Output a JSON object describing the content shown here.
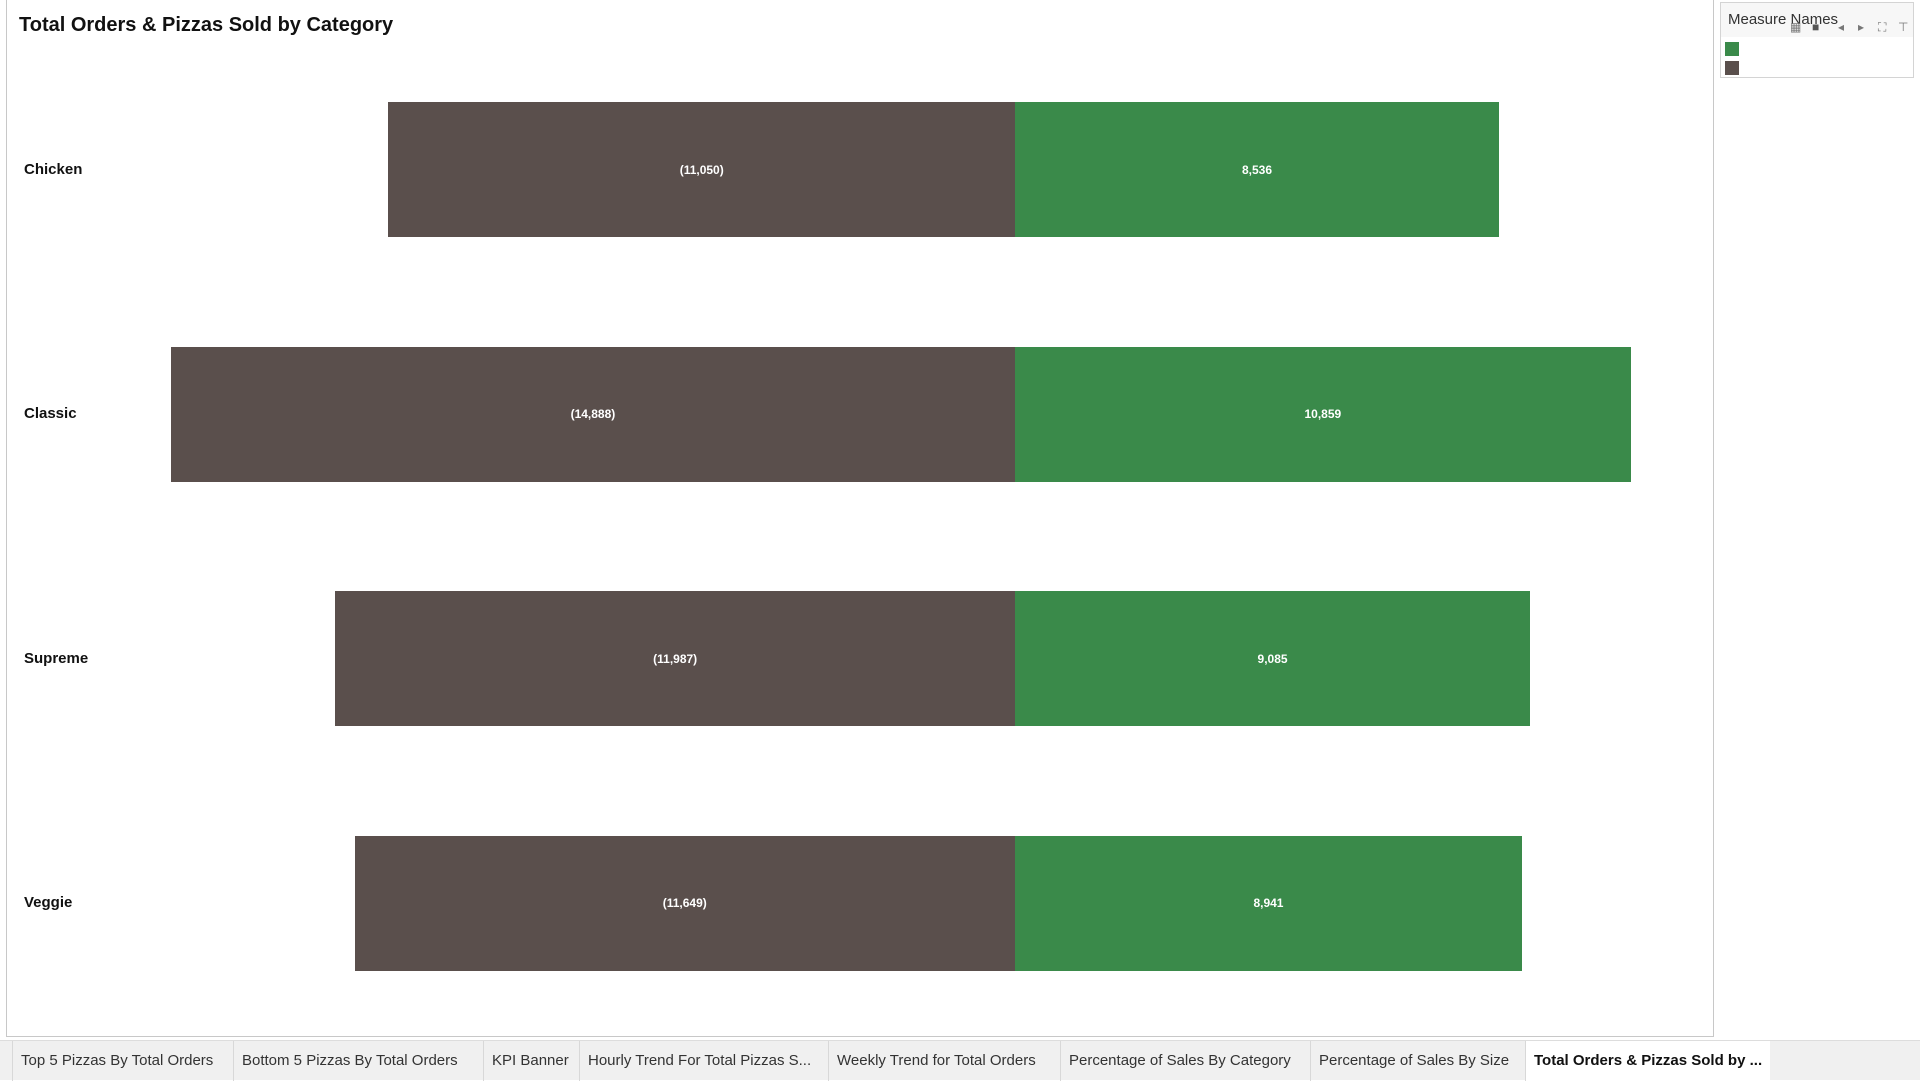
{
  "chart_data": {
    "type": "bar",
    "title": "Total Orders & Pizzas Sold by Category",
    "categories": [
      "Chicken",
      "Classic",
      "Supreme",
      "Veggie"
    ],
    "series": [
      {
        "color": "#5a4f4c",
        "values": [
          -11050,
          -14888,
          -11987,
          -11649
        ],
        "labels": [
          "(11,050)",
          "(14,888)",
          "(11,987)",
          "(11,649)"
        ]
      },
      {
        "color": "#3a8a4a",
        "values": [
          8536,
          10859,
          9085,
          8941
        ],
        "labels": [
          "8,536",
          "10,859",
          "9,085",
          "8,941"
        ]
      }
    ],
    "legend": {
      "title": "Measure Names",
      "placement": "top-right",
      "colors": [
        "#3a8a4a",
        "#5a4f4c"
      ]
    }
  },
  "tabs": [
    "Top 5 Pizzas By Total Orders",
    "Bottom 5 Pizzas By Total Orders",
    "KPI Banner",
    "Hourly Trend For Total Pizzas S...",
    "Weekly Trend for Total Orders",
    "Percentage of Sales By Category",
    "Percentage of Sales By Size",
    "Total Orders & Pizzas Sold by ..."
  ],
  "active_tab": 7
}
